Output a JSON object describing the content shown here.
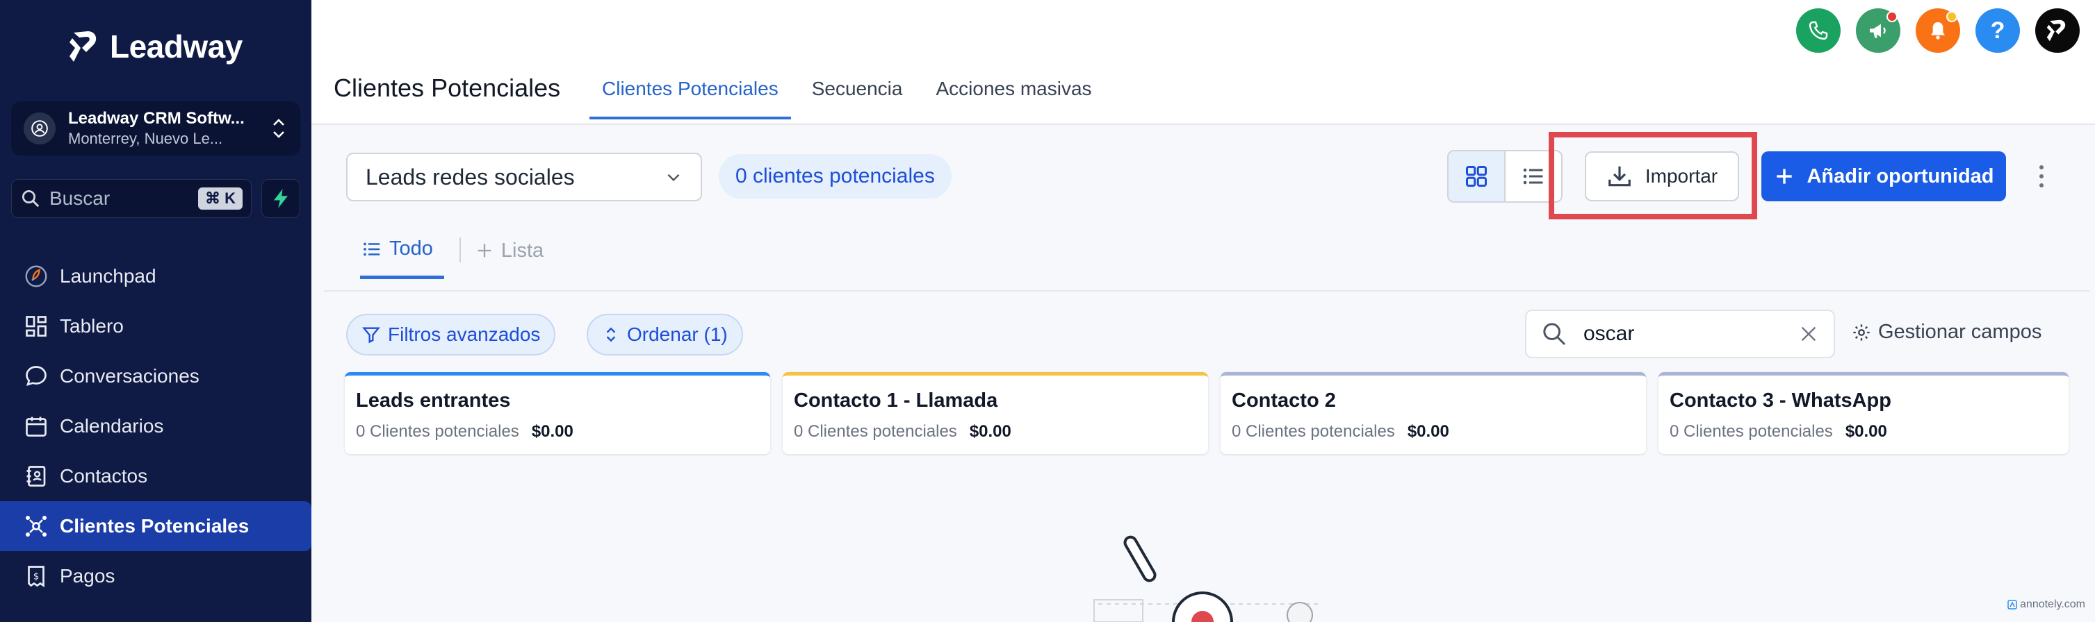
{
  "sidebar": {
    "logo_text": "Leadway",
    "account": {
      "name": "Leadway CRM Softw...",
      "location": "Monterrey, Nuevo Le..."
    },
    "search": {
      "placeholder": "Buscar",
      "shortcut": "⌘ K"
    },
    "items": [
      {
        "label": "Launchpad",
        "icon": "rocket-icon"
      },
      {
        "label": "Tablero",
        "icon": "dashboard-icon"
      },
      {
        "label": "Conversaciones",
        "icon": "chat-icon"
      },
      {
        "label": "Calendarios",
        "icon": "calendar-icon"
      },
      {
        "label": "Contactos",
        "icon": "contacts-icon"
      },
      {
        "label": "Clientes Potenciales",
        "icon": "pipeline-icon",
        "active": true
      },
      {
        "label": "Pagos",
        "icon": "payments-icon"
      }
    ]
  },
  "header": {
    "title": "Clientes Potenciales",
    "tabs": [
      "Clientes Potenciales",
      "Secuencia",
      "Acciones masivas"
    ],
    "icons": [
      {
        "name": "phone-icon",
        "color": "#1aa260"
      },
      {
        "name": "megaphone-icon",
        "color": "#3a9f6a",
        "badge": "#e53935"
      },
      {
        "name": "bell-icon",
        "color": "#f97316",
        "badge": "#fbbf24"
      },
      {
        "name": "help-icon",
        "color": "#2a8cf0"
      },
      {
        "name": "brand-icon",
        "color": "#0a0a0a"
      }
    ]
  },
  "toolbar": {
    "pipeline": "Leads redes sociales",
    "count": "0 clientes potenciales",
    "import_label": "Importar",
    "add_label": "Añadir oportunidad"
  },
  "subtabs": {
    "all": "Todo",
    "list": "Lista"
  },
  "filters": {
    "advanced": "Filtros avanzados",
    "sort": "Ordenar (1)",
    "search_value": "oscar",
    "manage_fields": "Gestionar campos"
  },
  "columns": [
    {
      "title": "Leads entrantes",
      "count": "0 Clientes potenciales",
      "amount": "$0.00",
      "color": "#2a8cf0"
    },
    {
      "title": "Contacto 1 - Llamada",
      "count": "0 Clientes potenciales",
      "amount": "$0.00",
      "color": "#f6c244"
    },
    {
      "title": "Contacto 2",
      "count": "0 Clientes potenciales",
      "amount": "$0.00",
      "color": "#a9b4d6"
    },
    {
      "title": "Contacto 3 - WhatsApp",
      "count": "0 Clientes potenciales",
      "amount": "$0.00",
      "color": "#a9b4d6"
    }
  ],
  "watermark": "annotely.com",
  "colors": {
    "sidebar_bg": "#0f1a45",
    "active_item": "#1a3da8",
    "primary": "#1a5ce6",
    "highlight": "#e0484f"
  }
}
